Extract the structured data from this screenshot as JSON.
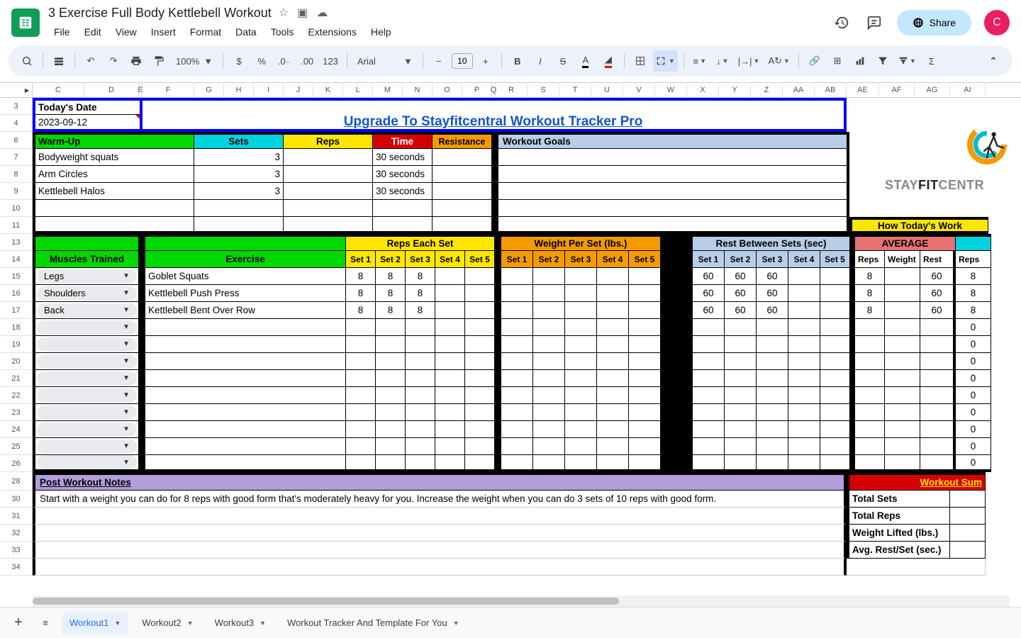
{
  "doc_title": "3 Exercise Full Body Kettlebell Workout",
  "menu": [
    "File",
    "Edit",
    "View",
    "Insert",
    "Format",
    "Data",
    "Tools",
    "Extensions",
    "Help"
  ],
  "share_label": "Share",
  "avatar_letter": "C",
  "zoom": "100%",
  "font_name": "Arial",
  "font_size": "10",
  "col_hdrs": [
    "C",
    "D",
    "E",
    "F",
    "G",
    "H",
    "I",
    "J",
    "K",
    "L",
    "M",
    "N",
    "O",
    "P",
    "Q",
    "R",
    "S",
    "T",
    "U",
    "V",
    "W",
    "X",
    "Y",
    "Z",
    "AA",
    "AB",
    "AE",
    "AF",
    "AG",
    "AI"
  ],
  "row_hdrs": [
    "3",
    "4",
    "6",
    "7",
    "8",
    "9",
    "10",
    "11",
    "13",
    "14",
    "15",
    "16",
    "17",
    "18",
    "19",
    "20",
    "21",
    "22",
    "23",
    "24",
    "25",
    "26",
    "28",
    "30",
    "31",
    "32",
    "33",
    "34"
  ],
  "today_label": "Today's Date",
  "today_value": "2023-09-12",
  "upgrade_link": "Upgrade To Stayfitcentral Workout Tracker Pro",
  "warmup_hdr": "Warm-Up",
  "sets_hdr": "Sets",
  "reps_hdr": "Reps",
  "time_hdr": "Time",
  "resist_hdr": "Resistance",
  "goals_hdr": "Workout Goals",
  "warmup_rows": [
    {
      "name": "Bodyweight squats",
      "sets": "3",
      "time": "30 seconds"
    },
    {
      "name": "Arm Circles",
      "sets": "3",
      "time": "30 seconds"
    },
    {
      "name": "Kettlebell Halos",
      "sets": "3",
      "time": "30 seconds"
    }
  ],
  "how_today": "How Today's Work",
  "logo_brand": "STAYFITCENTR",
  "muscles_hdr": "Muscles Trained",
  "exercise_hdr": "Exercise",
  "reps_each_hdr": "Reps Each Set",
  "weight_per_hdr": "Weight Per Set (lbs.)",
  "rest_between_hdr": "Rest Between Sets (sec)",
  "average_hdr": "AVERAGE",
  "set_labels": [
    "Set 1",
    "Set 2",
    "Set 3",
    "Set 4",
    "Set 5"
  ],
  "avg_labels": {
    "reps": "Reps",
    "weight": "Weight",
    "rest": "Rest"
  },
  "total_reps_ai": "Reps",
  "workout_rows": [
    {
      "muscle": "Legs",
      "exercise": "Goblet Squats",
      "reps": [
        "8",
        "8",
        "8",
        "",
        ""
      ],
      "weight": [
        "",
        "",
        "",
        "",
        ""
      ],
      "rest": [
        "60",
        "60",
        "60",
        "",
        ""
      ],
      "avg_reps": "8",
      "avg_weight": "",
      "avg_rest": "60",
      "ai": "8"
    },
    {
      "muscle": "Shoulders",
      "exercise": "Kettlebell Push Press",
      "reps": [
        "8",
        "8",
        "8",
        "",
        ""
      ],
      "weight": [
        "",
        "",
        "",
        "",
        ""
      ],
      "rest": [
        "60",
        "60",
        "60",
        "",
        ""
      ],
      "avg_reps": "8",
      "avg_weight": "",
      "avg_rest": "60",
      "ai": "8"
    },
    {
      "muscle": "Back",
      "exercise": "Kettlebell Bent Over Row",
      "reps": [
        "8",
        "8",
        "8",
        "",
        ""
      ],
      "weight": [
        "",
        "",
        "",
        "",
        ""
      ],
      "rest": [
        "60",
        "60",
        "60",
        "",
        ""
      ],
      "avg_reps": "8",
      "avg_weight": "",
      "avg_rest": "60",
      "ai": "8"
    }
  ],
  "empty_row_ai": "0",
  "post_notes_hdr": "Post Workout Notes",
  "workout_sum_hdr": "Workout Sum",
  "notes_text": "Start with a weight you can do for 8 reps with good form that's moderately heavy for you. Increase the weight when you can do 3 sets of 10 reps with good form.",
  "summary_rows": [
    "Total Sets",
    "Total Reps",
    "Weight Lifted (lbs.)",
    "Avg. Rest/Set (sec.)"
  ],
  "tabs": [
    "Workout1",
    "Workout2",
    "Workout3",
    "Workout Tracker And Template For You"
  ]
}
